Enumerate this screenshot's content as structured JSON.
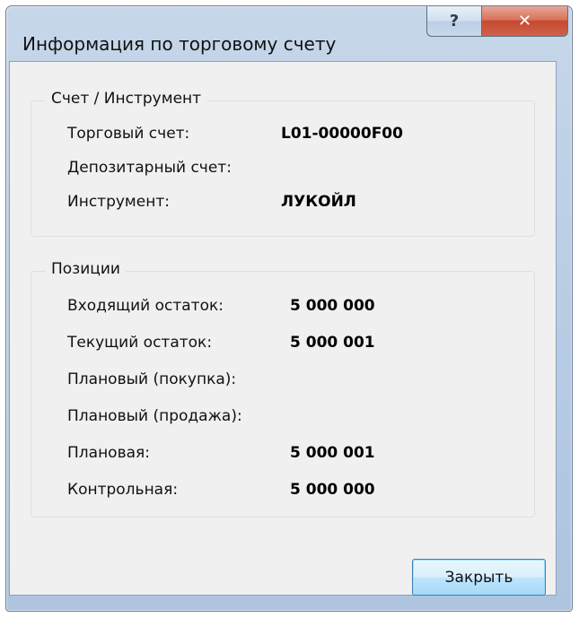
{
  "window": {
    "title": "Информация по торговому счету",
    "help_glyph": "?",
    "close_glyph": "✕"
  },
  "account_group": {
    "legend": "Счет / Инструмент",
    "rows": [
      {
        "label": "Торговый счет:",
        "value": "L01-00000F00"
      },
      {
        "label": "Депозитарный счет:",
        "value": ""
      },
      {
        "label": "Инструмент:",
        "value": "ЛУКОЙЛ"
      }
    ]
  },
  "positions_group": {
    "legend": "Позиции",
    "rows": [
      {
        "label": "Входящий остаток:",
        "value": "5 000 000"
      },
      {
        "label": "Текущий остаток:",
        "value": "5 000 001"
      },
      {
        "label": "Плановый (покупка):",
        "value": ""
      },
      {
        "label": "Плановый (продажа):",
        "value": ""
      },
      {
        "label": "Плановая:",
        "value": "5 000 001"
      },
      {
        "label": "Контрольная:",
        "value": "5 000 000"
      }
    ]
  },
  "buttons": {
    "close_label": "Закрыть"
  }
}
